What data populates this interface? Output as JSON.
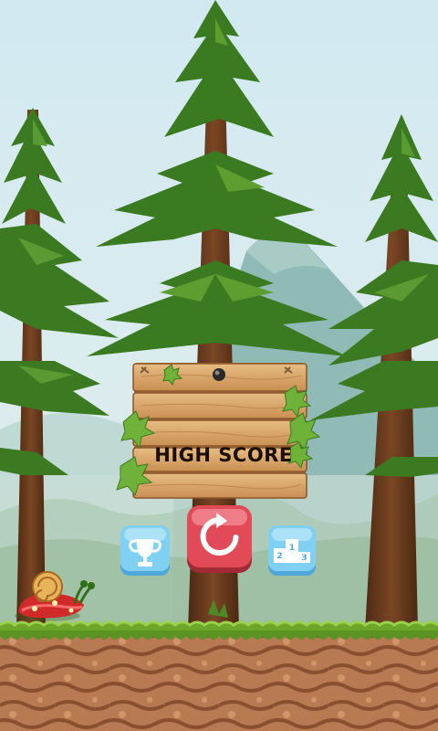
{
  "screen": "game-over",
  "sign": {
    "title": "HIGH SCORE"
  },
  "buttons": [
    {
      "id": "trophy",
      "icon": "trophy-icon"
    },
    {
      "id": "restart",
      "icon": "restart-arrow-icon"
    },
    {
      "id": "leaderboard",
      "icon": "podium-icon",
      "podium_numbers": [
        "1",
        "2",
        "3"
      ]
    }
  ],
  "colors": {
    "sky": "#d8ecf1",
    "mountain": "#8fbab6",
    "pine": "#3f7f24",
    "trunk": "#6b3c1c",
    "sign_wood": "#d9a86a",
    "title_text": "#1a0e06",
    "restart_button": "#d9404e",
    "blue_button": "#6dc6ee",
    "grass": "#6da72a",
    "soil": "#b2714a"
  }
}
